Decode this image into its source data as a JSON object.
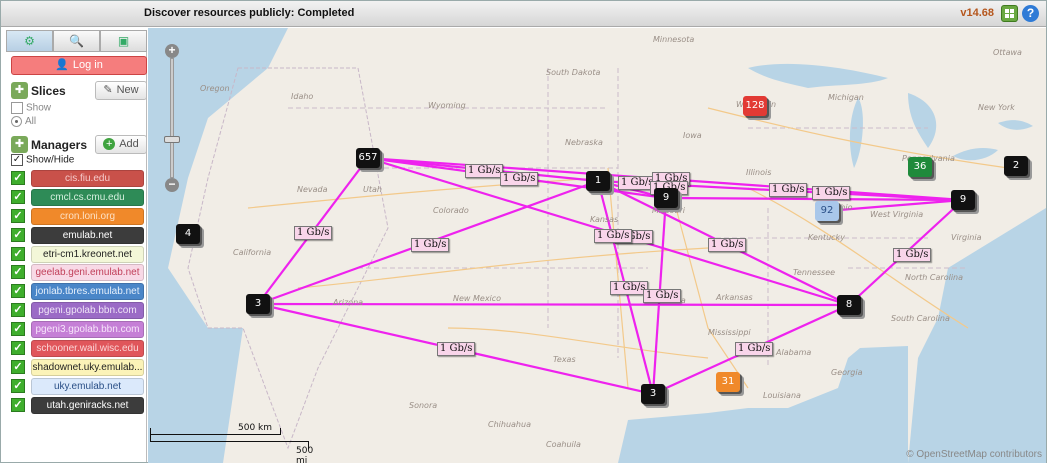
{
  "titlebar": {
    "title": "Discover resources publicly: Completed",
    "version": "v14.68",
    "grid_icon": "grid-icon",
    "help_icon": "?"
  },
  "sidebar": {
    "tabs": [
      {
        "icon": "sliders-icon",
        "glyph": "⚙"
      },
      {
        "icon": "search-icon",
        "glyph": "🔍"
      },
      {
        "icon": "monitor-icon",
        "glyph": "▣"
      }
    ],
    "login_label": "Log in",
    "slices": {
      "label": "Slices",
      "new_label": "New",
      "show_label": "Show",
      "all_label": "All"
    },
    "managers": {
      "label": "Managers",
      "add_label": "Add",
      "show_hide_label": "Show/Hide",
      "items": [
        {
          "name": "cis.fiu.edu",
          "bg": "#c9514a",
          "fg": "#f6cccc"
        },
        {
          "name": "cmcl.cs.cmu.edu",
          "bg": "#2e8b57",
          "fg": "#d6f0df"
        },
        {
          "name": "cron.loni.org",
          "bg": "#f0892a",
          "fg": "#fde2c7"
        },
        {
          "name": "emulab.net",
          "bg": "#3c3c3c",
          "fg": "#ffffff"
        },
        {
          "name": "etri-cm1.kreonet.net",
          "bg": "#f3f7d8",
          "fg": "#222222"
        },
        {
          "name": "geelab.geni.emulab.net",
          "bg": "#f8d9e6",
          "fg": "#c1405a"
        },
        {
          "name": "jonlab.tbres.emulab.net",
          "bg": "#4a86c8",
          "fg": "#e6f0fb"
        },
        {
          "name": "pgeni.gpolab.bbn.com",
          "bg": "#9b6bc6",
          "fg": "#efe4f7"
        },
        {
          "name": "pgeni3.gpolab.bbn.com",
          "bg": "#c57fd6",
          "fg": "#f7e6fb"
        },
        {
          "name": "schooner.wail.wisc.edu",
          "bg": "#e0565b",
          "fg": "#fbd5d6"
        },
        {
          "name": "shadownet.uky.emulab...",
          "bg": "#fbf3b8",
          "fg": "#222222"
        },
        {
          "name": "uky.emulab.net",
          "bg": "#dbe9fb",
          "fg": "#2a4f86"
        },
        {
          "name": "utah.geniracks.net",
          "bg": "#3c3c3c",
          "fg": "#ffffff"
        }
      ]
    }
  },
  "map": {
    "scale_km": "500 km",
    "scale_mi": "500 mi",
    "attribution": "© OpenStreetMap contributors",
    "places": [
      {
        "name": "Oregon"
      },
      {
        "name": "Idaho"
      },
      {
        "name": "Wyoming"
      },
      {
        "name": "South Dakota"
      },
      {
        "name": "Nebraska"
      },
      {
        "name": "Nevada"
      },
      {
        "name": "Utah"
      },
      {
        "name": "Colorado"
      },
      {
        "name": "Kansas"
      },
      {
        "name": "California"
      },
      {
        "name": "Arizona"
      },
      {
        "name": "New Mexico"
      },
      {
        "name": "Texas"
      },
      {
        "name": "Oklahoma"
      },
      {
        "name": "Missouri"
      },
      {
        "name": "Iowa"
      },
      {
        "name": "Illinois"
      },
      {
        "name": "Wisconsin"
      },
      {
        "name": "Michigan"
      },
      {
        "name": "Ohio"
      },
      {
        "name": "Kentucky"
      },
      {
        "name": "Tennessee"
      },
      {
        "name": "Arkansas"
      },
      {
        "name": "Mississippi"
      },
      {
        "name": "Alabama"
      },
      {
        "name": "Georgia"
      },
      {
        "name": "Louisiana"
      },
      {
        "name": "Minnesota"
      },
      {
        "name": "North Carolina"
      },
      {
        "name": "South Carolina"
      },
      {
        "name": "Virginia"
      },
      {
        "name": "West Virginia"
      },
      {
        "name": "Pennsylvania"
      },
      {
        "name": "New York"
      },
      {
        "name": "Ottawa"
      },
      {
        "name": "Sonora"
      },
      {
        "name": "Chihuahua"
      },
      {
        "name": "Coahuila"
      }
    ],
    "nodes": [
      {
        "label": "657",
        "color": "#111111"
      },
      {
        "label": "4",
        "color": "#111111"
      },
      {
        "label": "3",
        "color": "#111111"
      },
      {
        "label": "1",
        "color": "#111111"
      },
      {
        "label": "9",
        "color": "#111111"
      },
      {
        "label": "128",
        "color": "#e23a34"
      },
      {
        "label": "36",
        "color": "#1f8a3b"
      },
      {
        "label": "2",
        "color": "#111111"
      },
      {
        "label": "92",
        "color": "#a9c7ea"
      },
      {
        "label": "9",
        "color": "#111111"
      },
      {
        "label": "8",
        "color": "#111111"
      },
      {
        "label": "3",
        "color": "#111111"
      },
      {
        "label": "31",
        "color": "#f0892a"
      }
    ],
    "link_label": "1 Gb/s",
    "link_color": "#ee22ee"
  }
}
